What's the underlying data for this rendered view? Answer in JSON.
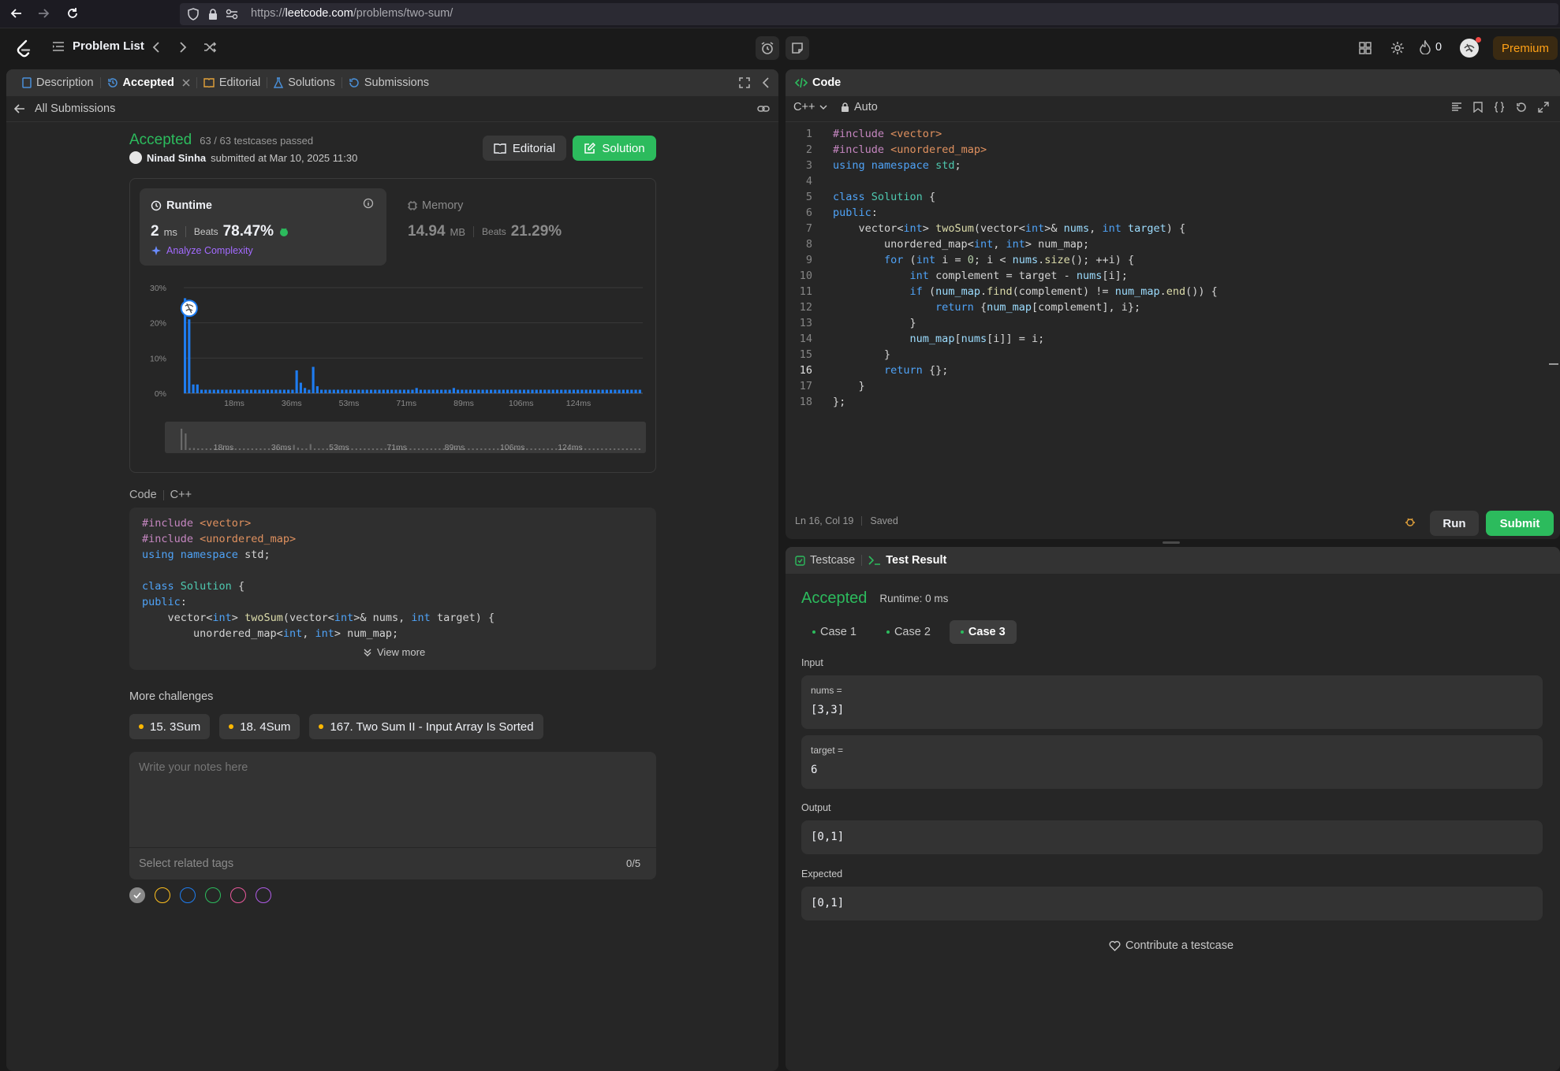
{
  "browser": {
    "url_prefix": "https://",
    "url_domain": "leetcode.com",
    "url_path": "/problems/two-sum/"
  },
  "nav": {
    "problem_list": "Problem List",
    "streak_count": "0",
    "premium": "Premium"
  },
  "left_tabs": {
    "description": "Description",
    "accepted": "Accepted",
    "editorial": "Editorial",
    "solutions": "Solutions",
    "submissions": "Submissions"
  },
  "submission": {
    "back_label": "All Submissions",
    "status": "Accepted",
    "testcases": "63 / 63 testcases passed",
    "user": "Ninad Sinha",
    "submitted_at": "submitted at Mar 10, 2025 11:30",
    "editorial_btn": "Editorial",
    "solution_btn": "Solution",
    "runtime_label": "Runtime",
    "runtime_value": "2",
    "runtime_unit": "ms",
    "beats_label": "Beats",
    "runtime_beats": "78.47%",
    "analyze": "Analyze Complexity",
    "memory_label": "Memory",
    "memory_value": "14.94",
    "memory_unit": "MB",
    "memory_beats": "21.29%",
    "code_label": "Code",
    "code_lang": "C++",
    "view_more": "View more",
    "more_challenges": "More challenges",
    "challenges": [
      "15. 3Sum",
      "18. 4Sum",
      "167. Two Sum II - Input Array Is Sorted"
    ],
    "notes_placeholder": "Write your notes here",
    "tags_placeholder": "Select related tags",
    "tags_count": "0/5",
    "tag_colors": [
      "#8a8a8a",
      "#ffc01e",
      "#1e7cf0",
      "#2cbb5d",
      "#e9589b",
      "#b05ce8"
    ]
  },
  "chart_data": {
    "type": "bar",
    "y_ticks": [
      "30%",
      "20%",
      "10%",
      "0%"
    ],
    "ylim": [
      0,
      30
    ],
    "x_ticks": [
      "18ms",
      "36ms",
      "53ms",
      "71ms",
      "89ms",
      "106ms",
      "124ms"
    ],
    "values": [
      27,
      21,
      2.5,
      2.5,
      1,
      1,
      1,
      1,
      1,
      1,
      1,
      1,
      1,
      1,
      1,
      1,
      1,
      1,
      1,
      1,
      1,
      1,
      1,
      1,
      1,
      1,
      1,
      6.5,
      3,
      1.5,
      1,
      7.5,
      2,
      1,
      1,
      1,
      1,
      1,
      1,
      1,
      1,
      1,
      1,
      1,
      1,
      1,
      1,
      1,
      1,
      1,
      1,
      1,
      1,
      1,
      1,
      1,
      1.5,
      1,
      1,
      1,
      1,
      1,
      1,
      1,
      1,
      1.5,
      1,
      1,
      1,
      1,
      1,
      1,
      1,
      1,
      1,
      1,
      1,
      1,
      1,
      1,
      1,
      1,
      1,
      1,
      1,
      1,
      1,
      1,
      1,
      1,
      1,
      1,
      1,
      1,
      1,
      1,
      1,
      1,
      1,
      1,
      1,
      1,
      1,
      1,
      1,
      1,
      1,
      1,
      1,
      1,
      1
    ],
    "highlight_index": 1,
    "bar_color": "#1e7cf0",
    "grid": true
  },
  "code": {
    "title": "Code",
    "language": "C++",
    "mode": "Auto",
    "status_pos": "Ln 16, Col 19",
    "status_saved": "Saved",
    "run": "Run",
    "submit": "Submit",
    "line_numbers": [
      "1",
      "2",
      "3",
      "4",
      "5",
      "6",
      "7",
      "8",
      "9",
      "10",
      "11",
      "12",
      "13",
      "14",
      "15",
      "16",
      "17",
      "18"
    ]
  },
  "result": {
    "testcase_tab": "Testcase",
    "result_tab": "Test Result",
    "status": "Accepted",
    "runtime": "Runtime: 0 ms",
    "cases": [
      "Case 1",
      "Case 2",
      "Case 3"
    ],
    "input_label": "Input",
    "nums_label": "nums =",
    "nums_value": "[3,3]",
    "target_label": "target =",
    "target_value": "6",
    "output_label": "Output",
    "output_value": "[0,1]",
    "expected_label": "Expected",
    "expected_value": "[0,1]",
    "contribute": "Contribute a testcase"
  },
  "colors": {
    "accent_green": "#2cbb5d",
    "premium": "#ffa116",
    "accepted": "#2cbb5d"
  }
}
